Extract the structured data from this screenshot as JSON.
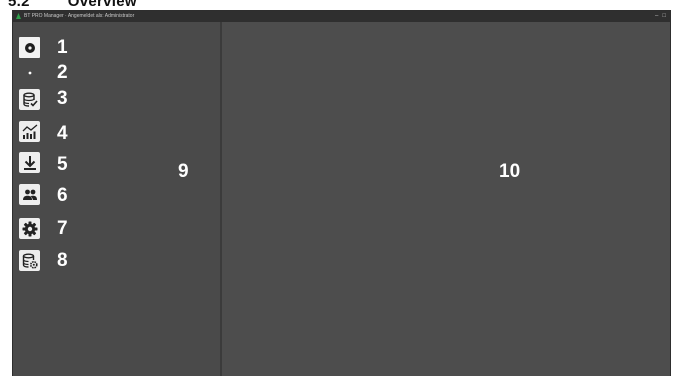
{
  "section_heading": {
    "number": "5.2",
    "title": "Overview"
  },
  "window": {
    "title": "BT PRO Manager · Angemeldet als: Administrator",
    "controls": [
      "–",
      "□"
    ]
  },
  "nav_icons": [
    {
      "icon": "record-icon"
    },
    {
      "icon": "dot-icon"
    },
    {
      "icon": "database-check-icon"
    },
    {
      "icon": "chart-icon"
    },
    {
      "icon": "download-icon"
    },
    {
      "icon": "users-icon"
    },
    {
      "icon": "gear-icon"
    },
    {
      "icon": "database-settings-icon"
    }
  ],
  "callouts": [
    "1",
    "2",
    "3",
    "4",
    "5",
    "6",
    "7",
    "8",
    "9",
    "10"
  ],
  "colors": {
    "window_bg": "#4a4a4a",
    "titlebar_bg": "#2f2f2f",
    "callout_text": "#ffffff",
    "icon_fg": "#222222"
  }
}
